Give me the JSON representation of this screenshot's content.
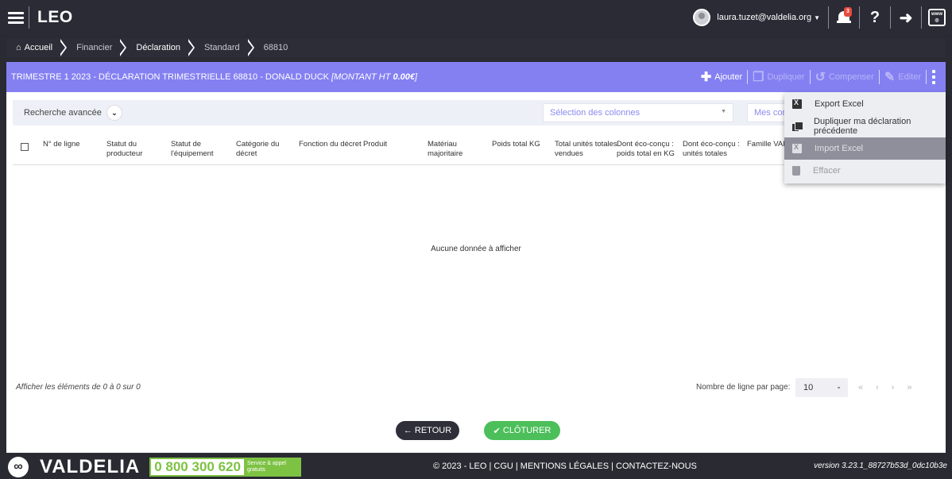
{
  "app": {
    "title": "LEO"
  },
  "user": {
    "email": "laura.tuzet@valdelia.org",
    "notifications": "3"
  },
  "breadcrumb": [
    "Accueil",
    "Financier",
    "Déclaration",
    "Standard",
    "68810"
  ],
  "header": {
    "title": "TRIMESTRE 1 2023 - DÉCLARATION TRIMESTRIELLE 68810 - DONALD DUCK ",
    "amount_label": "[MONTANT HT ",
    "amount_value": "0.00€",
    "amount_close": "]",
    "actions": {
      "add": "Ajouter",
      "duplicate": "Dupliquer",
      "compensate": "Compenser",
      "edit": "Editer"
    }
  },
  "search": {
    "advanced_label": "Recherche avancée",
    "columns_placeholder": "Sélection des colonnes",
    "config_placeholder": "Mes configurations"
  },
  "table": {
    "columns": [
      "N° de ligne",
      "Statut du producteur",
      "Statut de l'équipement",
      "Catégorie du décret",
      "Fonction du décret",
      "Produit",
      "Matériau majoritaire",
      "Poids total KG",
      "Total unités totales vendues",
      "Dont éco-conçu : poids total en KG",
      "Dont éco-conçu : unités totales",
      "Famille VALDELIA"
    ],
    "empty_message": "Aucune donnée à afficher"
  },
  "pagination": {
    "info": "Afficher les éléments de 0 à 0 sur 0",
    "per_page_label": "Nombre de ligne par page:",
    "per_page_value": "10",
    "first": "«",
    "prev": "‹",
    "next": "›",
    "last": "»"
  },
  "buttons": {
    "back": "RETOUR",
    "close": "CLÔTURER"
  },
  "menu": {
    "items": [
      "Export Excel",
      "Dupliquer ma déclaration précédente",
      "Import Excel",
      "Effacer"
    ]
  },
  "footer": {
    "brand": "VALDELIA",
    "phone": "0 800 300 620",
    "phone_tag": "Service & appel gratuits",
    "links": "© 2023 - LEO | CGU | MENTIONS LÉGALES | CONTACTEZ-NOUS",
    "version": "version 3.23.1_88727b53d_0dc10b3e"
  },
  "colors": {
    "header": "#8480f2",
    "topbar": "#2b2b36",
    "success": "#4cbf5a",
    "phone_green": "#7dc243"
  }
}
